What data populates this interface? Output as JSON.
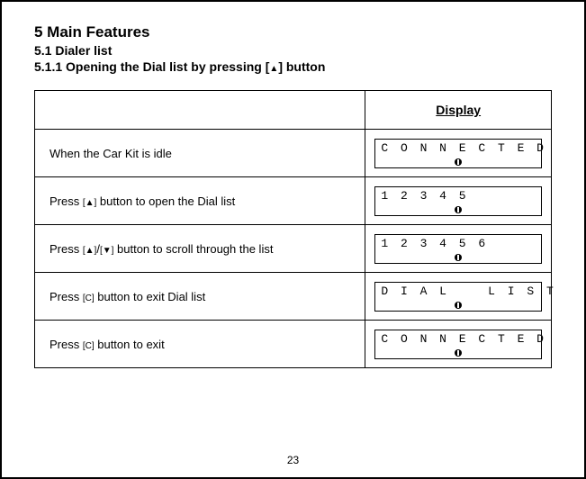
{
  "headings": {
    "h1": "5  Main Features",
    "h2": "5.1  Dialer list",
    "h3_pre": "5.1.1  Opening the Dial list by pressing  [",
    "h3_key": "▲",
    "h3_post": "]  button"
  },
  "table": {
    "header_display": "Display",
    "rows": [
      {
        "desc_parts": [
          "When the Car Kit is idle"
        ],
        "lcd": "C O N N E C T E D"
      },
      {
        "desc_parts": [
          "Press ",
          "[▲]",
          " button to open the Dial list"
        ],
        "lcd": "1 2 3 4 5"
      },
      {
        "desc_parts": [
          "Press ",
          "[▲]",
          "/",
          "[▼]",
          " button to scroll through the list"
        ],
        "lcd": "1 2 3 4 5 6"
      },
      {
        "desc_parts": [
          "Press ",
          "[C]",
          " button to exit Dial list"
        ],
        "lcd": "D I A L    L I S T"
      },
      {
        "desc_parts": [
          "Press ",
          "[C]",
          " button to exit"
        ],
        "lcd": "C O N N E C T E D"
      }
    ]
  },
  "page_number": "23"
}
